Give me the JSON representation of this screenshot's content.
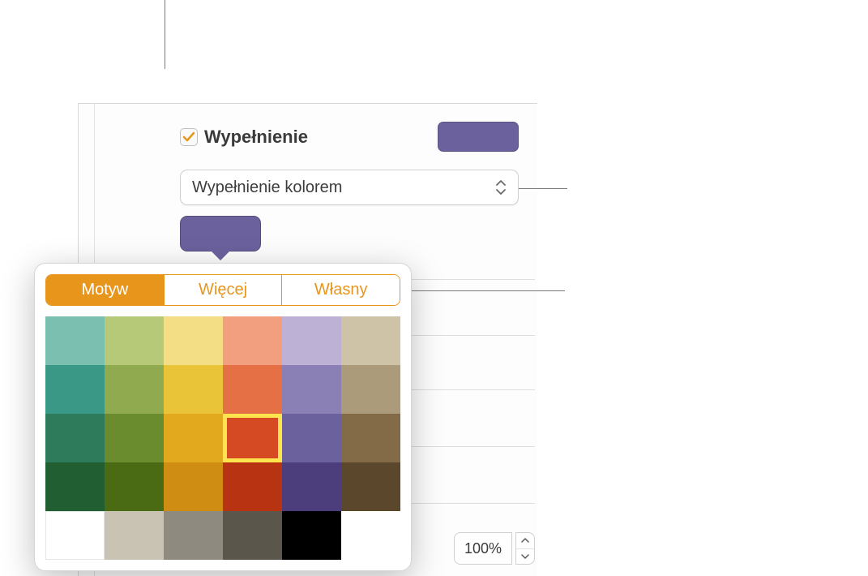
{
  "fill": {
    "checkbox_checked": true,
    "label": "Wypełnienie",
    "preview_color": "#6b619d",
    "dropdown_label": "Wypełnienie kolorem",
    "well_color": "#6b619d"
  },
  "popover": {
    "tabs": [
      "Motyw",
      "Więcej",
      "Własny"
    ],
    "active_tab": 0,
    "selected_index": 15,
    "swatches": [
      "#7bbfb0",
      "#b6c978",
      "#f3de86",
      "#f19f7f",
      "#beb1d6",
      "#cec3a7",
      "#3a9886",
      "#8faa4f",
      "#e9c439",
      "#e57045",
      "#8a80b6",
      "#ac9b7a",
      "#2d7b5a",
      "#6a8c2f",
      "#e2a81e",
      "#d54a23",
      "#6b619d",
      "#836b47",
      "#215e31",
      "#4b6a14",
      "#d08d13",
      "#b83312",
      "#4c3e7d",
      "#5a472c",
      "#ffffff",
      "#c9c3b4",
      "#8f8a7f",
      "#5a564c",
      "#000000",
      ""
    ],
    "swatch_count": 29
  },
  "opacity": {
    "value": "100%"
  },
  "accent_color": "#e8951c",
  "checkmark_color": "#e8951c"
}
